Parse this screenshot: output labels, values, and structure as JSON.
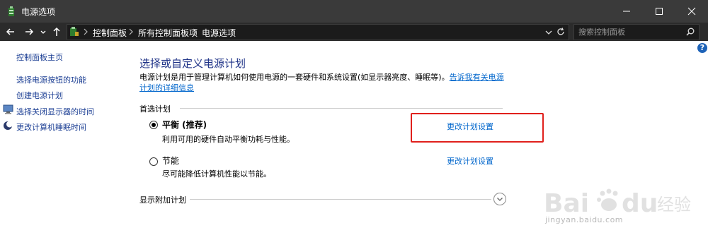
{
  "window": {
    "title": "电源选项"
  },
  "address": {
    "crumbs": [
      "控制面板",
      "所有控制面板项",
      "电源选项"
    ],
    "search_placeholder": "搜索控制面板"
  },
  "icons": {
    "app": "power-options-icon",
    "back": "arrow-left-icon",
    "forward": "arrow-right-icon",
    "recent": "chevron-down-icon",
    "up": "arrow-up-icon",
    "refresh": "refresh-icon",
    "search": "search-icon",
    "help": "help-icon"
  },
  "help": {
    "glyph": "?"
  },
  "sidebar": {
    "home": "控制面板主页",
    "links": [
      "选择电源按钮的功能",
      "创建电源计划",
      "选择关闭显示器的时间",
      "更改计算机睡眠时间"
    ]
  },
  "main": {
    "heading": "选择或自定义电源计划",
    "description": "电源计划是用于管理计算机如何使用电源的一套硬件和系统设置(如显示器亮度、睡眠等)。",
    "description_link": "告诉我有关电源计划的详细信息",
    "preferred_label": "首选计划",
    "plans": [
      {
        "name": "平衡 (推荐)",
        "description": "利用可用的硬件自动平衡功耗与性能。",
        "link": "更改计划设置",
        "selected": true
      },
      {
        "name": "节能",
        "description": "尽可能降低计算机性能以节能。",
        "link": "更改计划设置",
        "selected": false
      }
    ],
    "additional_label": "显示附加计划"
  },
  "watermark": {
    "logo": "Bai du 经验",
    "url": "jingyan.baidu.com"
  },
  "colors": {
    "titlebar": "#3a3a3a",
    "addressbar": "#2b2b2b",
    "link": "#0066cc",
    "heading": "#1e3287",
    "highlight": "#e0201c"
  }
}
